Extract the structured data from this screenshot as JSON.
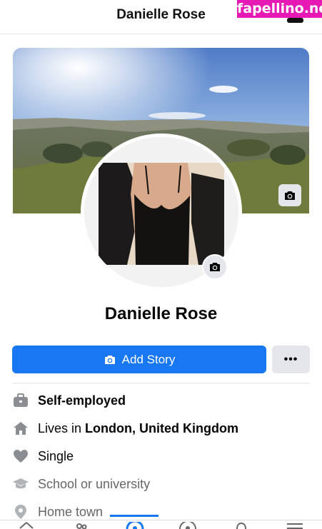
{
  "header": {
    "title": "Danielle Rose",
    "watermark": "fapellino.net"
  },
  "profile": {
    "name": "Danielle Rose"
  },
  "actions": {
    "add_story_label": "Add Story",
    "more_label": "•••"
  },
  "details": {
    "work": "Self-employed",
    "lives_prefix": "Lives in ",
    "lives_place": "London, United Kingdom",
    "relationship": "Single",
    "school": "School or university",
    "hometown": "Home town"
  },
  "icons": {
    "cover_camera": "camera-icon",
    "avatar_camera": "camera-icon",
    "work": "briefcase-icon",
    "lives": "home-icon",
    "relationship": "heart-icon",
    "school": "graduation-cap-icon",
    "hometown": "location-pin-icon"
  },
  "colors": {
    "accent": "#1877f2",
    "secondary_button": "#e4e6eb",
    "muted_text": "#65676b",
    "watermark_bg": "#e619b4"
  }
}
